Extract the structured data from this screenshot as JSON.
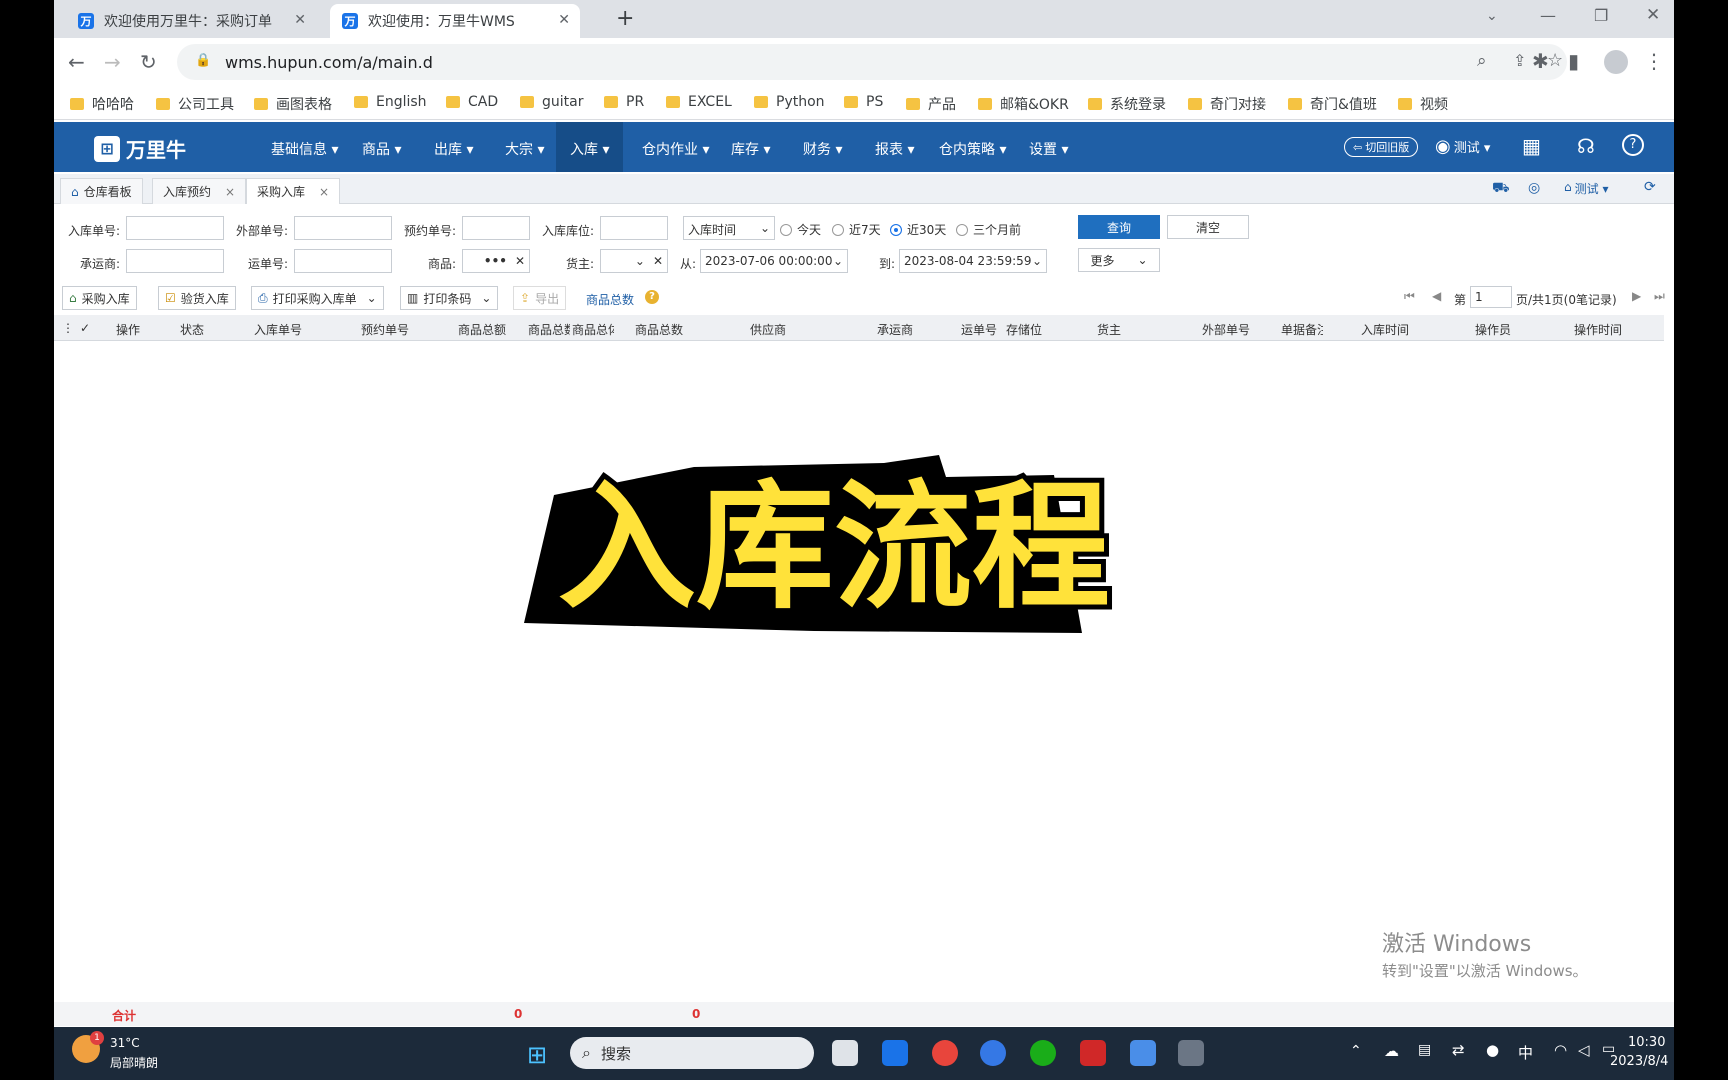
{
  "browser": {
    "tabs": [
      {
        "title": "欢迎使用万里牛：采购订单",
        "favicon": "万"
      },
      {
        "title": "欢迎使用：万里牛WMS",
        "favicon": "万"
      }
    ],
    "new_tab": "+",
    "url": "wms.hupun.com/a/main.d",
    "bookmarks": [
      "哈哈哈",
      "公司工具",
      "画图表格",
      "English",
      "CAD",
      "guitar",
      "PR",
      "EXCEL",
      "Python",
      "PS",
      "产品",
      "邮箱&OKR",
      "系统登录",
      "奇门对接",
      "奇门&值班",
      "视频"
    ]
  },
  "app": {
    "logo": "万里牛",
    "menu": [
      "基础信息 ▾",
      "商品 ▾",
      "出库 ▾",
      "大宗 ▾",
      "入库 ▾",
      "仓内作业 ▾",
      "库存 ▾",
      "财务 ▾",
      "报表 ▾",
      "仓内策略 ▾",
      "设置 ▾"
    ],
    "active_menu": "入库 ▾",
    "switch_old": "切回旧版",
    "user": "测试 ▾",
    "tabs": [
      {
        "label": "仓库看板"
      },
      {
        "label": "入库预约",
        "close": "×"
      },
      {
        "label": "采购入库",
        "close": "×"
      }
    ],
    "tab_right_user": "测试 ▾"
  },
  "form": {
    "row1": {
      "inbound_no": "入库单号:",
      "external_no": "外部单号:",
      "reservation_no": "预约单号:",
      "inbound_location": "入库库位:",
      "time_type": "入库时间",
      "today": "今天",
      "last7": "近7天",
      "last30": "近30天",
      "three_months": "三个月前",
      "query": "查询",
      "clear": "清空"
    },
    "row2": {
      "carrier": "承运商:",
      "waybill": "运单号:",
      "product": "商品:",
      "product_value": "•••",
      "owner": "货主:",
      "from": "从:",
      "from_value": "2023-07-06 00:00:00",
      "to": "到:",
      "to_value": "2023-08-04 23:59:59",
      "more": "更多"
    }
  },
  "toolbar": {
    "purchase_in": "采购入库",
    "inspect_in": "验货入库",
    "print_order": "打印采购入库单",
    "print_barcode": "打印条码",
    "export": "导出",
    "total_label": "商品总数",
    "page_prefix": "第",
    "page_value": "1",
    "page_suffix": "页/共1页(0笔记录)"
  },
  "table": {
    "columns": [
      "操作",
      "状态",
      "入库单号",
      "预约单号",
      "商品总额",
      "商品总数",
      "商品总体",
      "商品总数",
      "供应商",
      "承运商",
      "运单号",
      "存储位",
      "货主",
      "外部单号",
      "单据备注",
      "入库时间",
      "操作员",
      "操作时间"
    ]
  },
  "banner": {
    "text": "入库流程"
  },
  "summary": {
    "label": "合计",
    "value1": "0",
    "value2": "0"
  },
  "watermark": {
    "line1": "激活 Windows",
    "line2": "转到\"设置\"以激活 Windows。"
  },
  "taskbar": {
    "weather_temp": "31°C",
    "weather_desc": "局部晴朗",
    "badge": "1",
    "search": "搜索",
    "ime": "中",
    "time": "10:30",
    "date": "2023/8/4"
  },
  "colors": {
    "header": "#1f5fa6",
    "accent": "#1f6fbf",
    "banner_fill": "#ffe23a"
  }
}
